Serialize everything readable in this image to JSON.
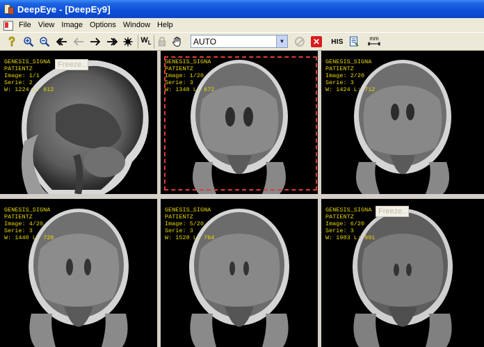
{
  "window": {
    "title": "DeepEye - [DeepEy9]"
  },
  "menu": [
    "File",
    "View",
    "Image",
    "Options",
    "Window",
    "Help"
  ],
  "toolbar": {
    "icons": [
      "help-icon",
      "zoom-in-icon",
      "zoom-out-icon",
      "first-icon",
      "prev-icon",
      "next-icon",
      "last-icon",
      "settings-icon",
      "window-level-icon",
      "lock-icon",
      "pan-hand-icon",
      "cancel-icon",
      "close-icon",
      "his-icon",
      "report-icon",
      "measure-icon"
    ],
    "wl_label": "W",
    "wl_sub": "L",
    "select_value": "AUTO",
    "his_label": "HIS",
    "mm_label": "mm"
  },
  "panes": [
    {
      "l1": "GENESIS_SIGNA",
      "l2": "PATIENTZ",
      "l3": "Image: 1/1",
      "l4": "Serie: 2",
      "l5": "W: 1224 L: 612",
      "freeze": "Freeze..",
      "view": "sagittal",
      "selected": false
    },
    {
      "l1": "GENESIS_SIGNA",
      "l2": "PATIENTZ",
      "l3": "Image: 1/20",
      "l4": "Serie: 3",
      "l5": "W: 1348 L: 672",
      "freeze": "",
      "view": "coronal",
      "selected": true
    },
    {
      "l1": "GENESIS_SIGNA",
      "l2": "PATIENTZ",
      "l3": "Image: 2/20",
      "l4": "Serie: 3",
      "l5": "W: 1424 L: 712",
      "freeze": "",
      "view": "coronal",
      "selected": false
    },
    {
      "l1": "GENESIS_SIGNA",
      "l2": "PATIENTZ",
      "l3": "Image: 4/20",
      "l4": "Serie: 3",
      "l5": "W: 1440 L: 720",
      "freeze": "",
      "view": "coronal",
      "selected": false
    },
    {
      "l1": "GENESIS_SIGNA",
      "l2": "PATIENTZ",
      "l3": "Image: 5/20",
      "l4": "Serie: 3",
      "l5": "W: 1528 L: 764",
      "freeze": "",
      "view": "coronal",
      "selected": false
    },
    {
      "l1": "GENESIS_SIGNA",
      "l2": "PATIENTZ",
      "l3": "Image: 6/20",
      "l4": "Serie: 3",
      "l5": "W: 1983 L: 991",
      "freeze": "Freeze..",
      "view": "coronal",
      "selected": false
    }
  ]
}
